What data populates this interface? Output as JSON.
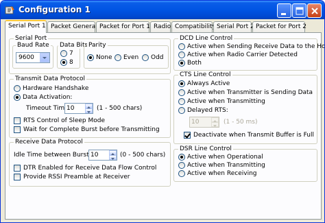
{
  "window": {
    "title": "Configuration 1"
  },
  "tabs": [
    {
      "label": "Serial Port 1"
    },
    {
      "label": "Packet General"
    },
    {
      "label": "Packet for Port 1"
    },
    {
      "label": "Radio"
    },
    {
      "label": "Compatibility"
    },
    {
      "label": "Serial Port 2"
    },
    {
      "label": "Packet for Port 2"
    }
  ],
  "serial_port": {
    "title": "Serial Port",
    "baud_rate": {
      "title": "Baud Rate",
      "value": "9600"
    },
    "data_bits": {
      "title": "Data Bits",
      "opt7": "7",
      "opt8": "8",
      "selected": "8"
    },
    "parity": {
      "title": "Parity",
      "none": "None",
      "even": "Even",
      "odd": "Odd",
      "selected": "None"
    }
  },
  "transmit": {
    "title": "Transmit Data Protocol",
    "hardware_handshake": "Hardware Handshake",
    "data_activation": "Data Activation:",
    "timeout_label": "Timeout Time:",
    "timeout_value": "10",
    "timeout_range": "(1 - 500 chars)",
    "rts_sleep": "RTS Control of Sleep Mode",
    "wait_burst": "Wait for Complete Burst before Transmitting"
  },
  "receive": {
    "title": "Receive Data Protocol",
    "idle_label": "Idle Time between Bursts:",
    "idle_value": "10",
    "idle_range": "(0 - 500 chars)",
    "dtr_enabled": "DTR Enabled for Receive Data Flow Control",
    "rssi": "Provide RSSI Preamble at Receiver"
  },
  "dcd": {
    "title": "DCD Line Control",
    "opt1": "Active when Sending Receive Data to the Host",
    "opt2": "Active when Radio Carrier Detected",
    "opt3": "Both"
  },
  "cts": {
    "title": "CTS Line Control",
    "opt1": "Always Active",
    "opt2": "Active when Transmitter is Sending Data",
    "opt3": "Active when Transmitting",
    "opt4": "Delayed RTS:",
    "delay_value": "10",
    "delay_range": "(1 - 50 ms)",
    "deactivate": "Deactivate when Transmit Buffer is Full"
  },
  "dsr": {
    "title": "DSR Line Control",
    "opt1": "Active when Operational",
    "opt2": "Active when Transmitting",
    "opt3": "Active when Receiving"
  }
}
